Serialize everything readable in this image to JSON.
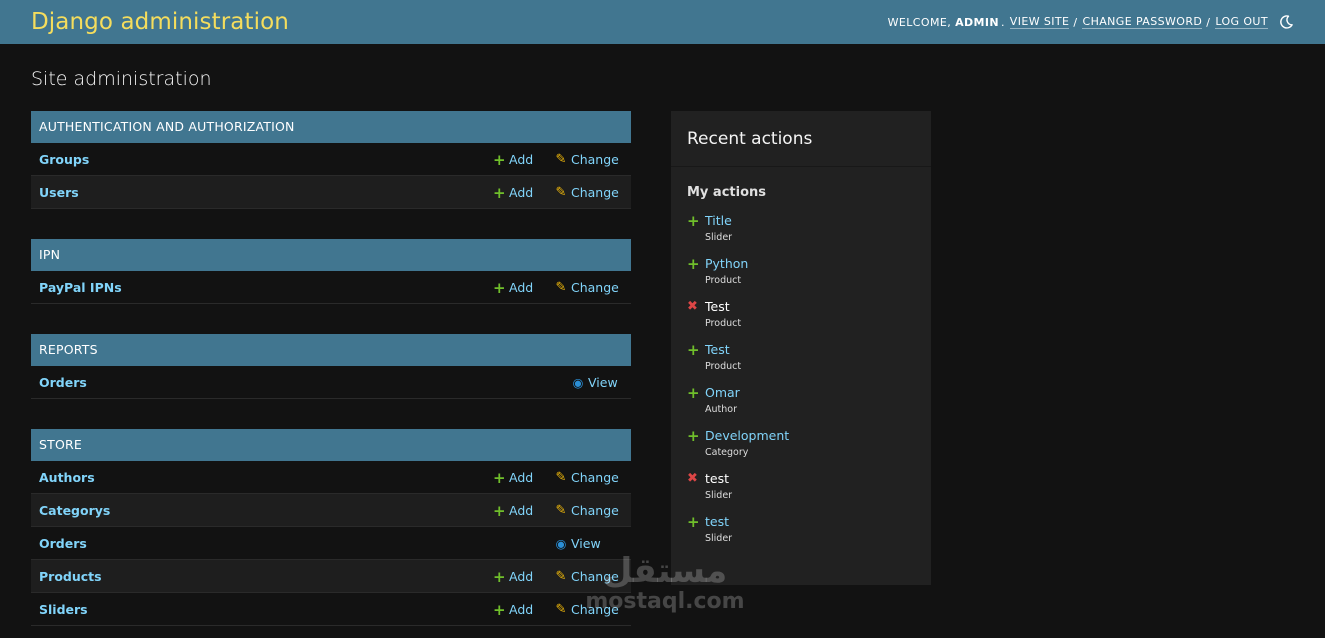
{
  "header": {
    "branding": "Django administration",
    "welcome": "WELCOME,",
    "username": "ADMIN",
    "view_site": "VIEW SITE",
    "change_password": "CHANGE PASSWORD",
    "log_out": "LOG OUT",
    "sep": "/"
  },
  "page_title": "Site administration",
  "apps": [
    {
      "name": "AUTHENTICATION AND AUTHORIZATION",
      "models": [
        {
          "name": "Groups",
          "add": "Add",
          "change": "Change"
        },
        {
          "name": "Users",
          "add": "Add",
          "change": "Change"
        }
      ]
    },
    {
      "name": "IPN",
      "models": [
        {
          "name": "PayPal IPNs",
          "add": "Add",
          "change": "Change"
        }
      ]
    },
    {
      "name": "REPORTS",
      "models": [
        {
          "name": "Orders",
          "view": "View"
        }
      ]
    },
    {
      "name": "STORE",
      "models": [
        {
          "name": "Authors",
          "add": "Add",
          "change": "Change"
        },
        {
          "name": "Categorys",
          "add": "Add",
          "change": "Change"
        },
        {
          "name": "Orders",
          "view": "View"
        },
        {
          "name": "Products",
          "add": "Add",
          "change": "Change"
        },
        {
          "name": "Sliders",
          "add": "Add",
          "change": "Change"
        }
      ]
    }
  ],
  "recent": {
    "title": "Recent actions",
    "subtitle": "My actions",
    "items": [
      {
        "icon": "plus-icon",
        "name": "Title",
        "type": "Slider"
      },
      {
        "icon": "plus-icon",
        "name": "Python",
        "type": "Product"
      },
      {
        "icon": "delete-icon",
        "name": "Test",
        "type": "Product"
      },
      {
        "icon": "plus-icon",
        "name": "Test",
        "type": "Product"
      },
      {
        "icon": "plus-icon",
        "name": "Omar",
        "type": "Author"
      },
      {
        "icon": "plus-icon",
        "name": "Development",
        "type": "Category"
      },
      {
        "icon": "delete-icon",
        "name": "test",
        "type": "Slider"
      },
      {
        "icon": "plus-icon",
        "name": "test",
        "type": "Slider"
      }
    ]
  },
  "watermark": {
    "arabic": "مستقل",
    "latin": "mostaql.com"
  },
  "colors": {
    "header": "#417690",
    "branding": "#f5dd5d",
    "link": "#81d4fa",
    "add": "#70bf2b",
    "change": "#efb80b",
    "delete": "#dd4646",
    "background": "#121212"
  }
}
